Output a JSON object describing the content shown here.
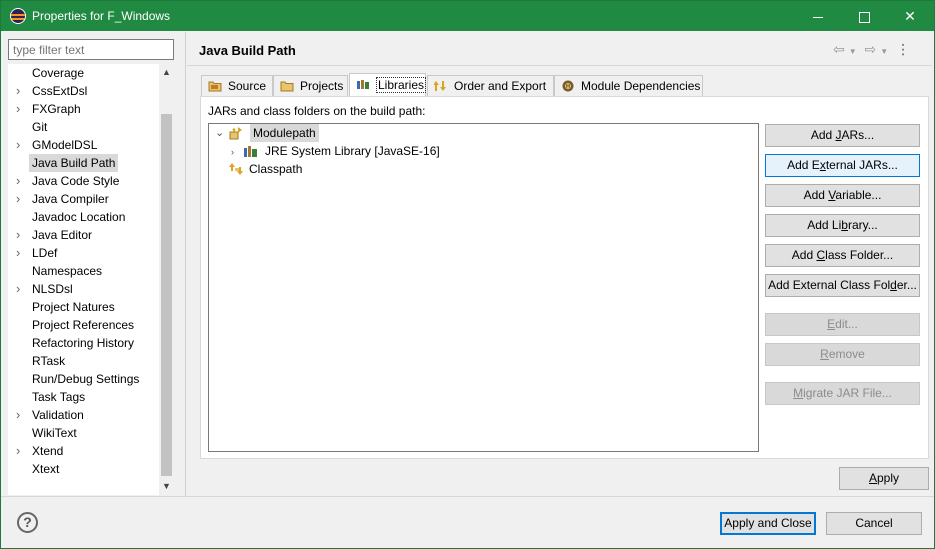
{
  "window": {
    "title": "Properties for F_Windows"
  },
  "filter": {
    "placeholder": "type filter text"
  },
  "sidebar": {
    "items": [
      {
        "label": "Coverage",
        "expandable": false,
        "selected": false
      },
      {
        "label": "CssExtDsl",
        "expandable": true,
        "selected": false
      },
      {
        "label": "FXGraph",
        "expandable": true,
        "selected": false
      },
      {
        "label": "Git",
        "expandable": false,
        "selected": false
      },
      {
        "label": "GModelDSL",
        "expandable": true,
        "selected": false
      },
      {
        "label": "Java Build Path",
        "expandable": false,
        "selected": true
      },
      {
        "label": "Java Code Style",
        "expandable": true,
        "selected": false
      },
      {
        "label": "Java Compiler",
        "expandable": true,
        "selected": false
      },
      {
        "label": "Javadoc Location",
        "expandable": false,
        "selected": false
      },
      {
        "label": "Java Editor",
        "expandable": true,
        "selected": false
      },
      {
        "label": "LDef",
        "expandable": true,
        "selected": false
      },
      {
        "label": "Namespaces",
        "expandable": false,
        "selected": false
      },
      {
        "label": "NLSDsl",
        "expandable": true,
        "selected": false
      },
      {
        "label": "Project Natures",
        "expandable": false,
        "selected": false
      },
      {
        "label": "Project References",
        "expandable": false,
        "selected": false
      },
      {
        "label": "Refactoring History",
        "expandable": false,
        "selected": false
      },
      {
        "label": "RTask",
        "expandable": false,
        "selected": false
      },
      {
        "label": "Run/Debug Settings",
        "expandable": false,
        "selected": false
      },
      {
        "label": "Task Tags",
        "expandable": false,
        "selected": false
      },
      {
        "label": "Validation",
        "expandable": true,
        "selected": false
      },
      {
        "label": "WikiText",
        "expandable": false,
        "selected": false
      },
      {
        "label": "Xtend",
        "expandable": true,
        "selected": false
      },
      {
        "label": "Xtext",
        "expandable": false,
        "selected": false
      }
    ]
  },
  "page": {
    "title": "Java Build Path"
  },
  "tabs": [
    {
      "label": "Source",
      "icon": "source-folder-icon",
      "active": false
    },
    {
      "label": "Projects",
      "icon": "projects-folder-icon",
      "active": false
    },
    {
      "label": "Libraries",
      "icon": "libraries-icon",
      "active": true
    },
    {
      "label": "Order and Export",
      "icon": "order-export-icon",
      "active": false
    },
    {
      "label": "Module Dependencies",
      "icon": "module-dependencies-icon",
      "active": false
    }
  ],
  "libraries": {
    "heading": "JARs and class folders on the build path:",
    "tree": [
      {
        "label": "Modulepath",
        "icon": "modulepath-icon",
        "expanded": true,
        "selected": true
      },
      {
        "label": "JRE System Library [JavaSE-16]",
        "icon": "jre-library-icon",
        "expanded": false,
        "selected": false
      },
      {
        "label": "Classpath",
        "icon": "classpath-icon",
        "expanded": false,
        "selected": false
      }
    ],
    "buttons": {
      "add_jars": {
        "pre": "Add ",
        "u": "J",
        "post": "ARs..."
      },
      "add_external_jars": {
        "pre": "Add E",
        "u": "x",
        "post": "ternal JARs..."
      },
      "add_variable": {
        "pre": "Add ",
        "u": "V",
        "post": "ariable..."
      },
      "add_library": {
        "pre": "Add Li",
        "u": "b",
        "post": "rary..."
      },
      "add_class_folder": {
        "pre": "Add ",
        "u": "C",
        "post": "lass Folder..."
      },
      "add_external_class_folder": {
        "pre": "Add External Class Fol",
        "u": "d",
        "post": "er..."
      },
      "edit": {
        "pre": "",
        "u": "E",
        "post": "dit..."
      },
      "remove": {
        "pre": "",
        "u": "R",
        "post": "emove"
      },
      "migrate_jar": {
        "pre": "",
        "u": "M",
        "post": "igrate JAR File..."
      }
    }
  },
  "footer": {
    "apply": {
      "pre": "",
      "u": "A",
      "post": "pply"
    },
    "apply_close": "Apply and Close",
    "cancel": "Cancel"
  }
}
